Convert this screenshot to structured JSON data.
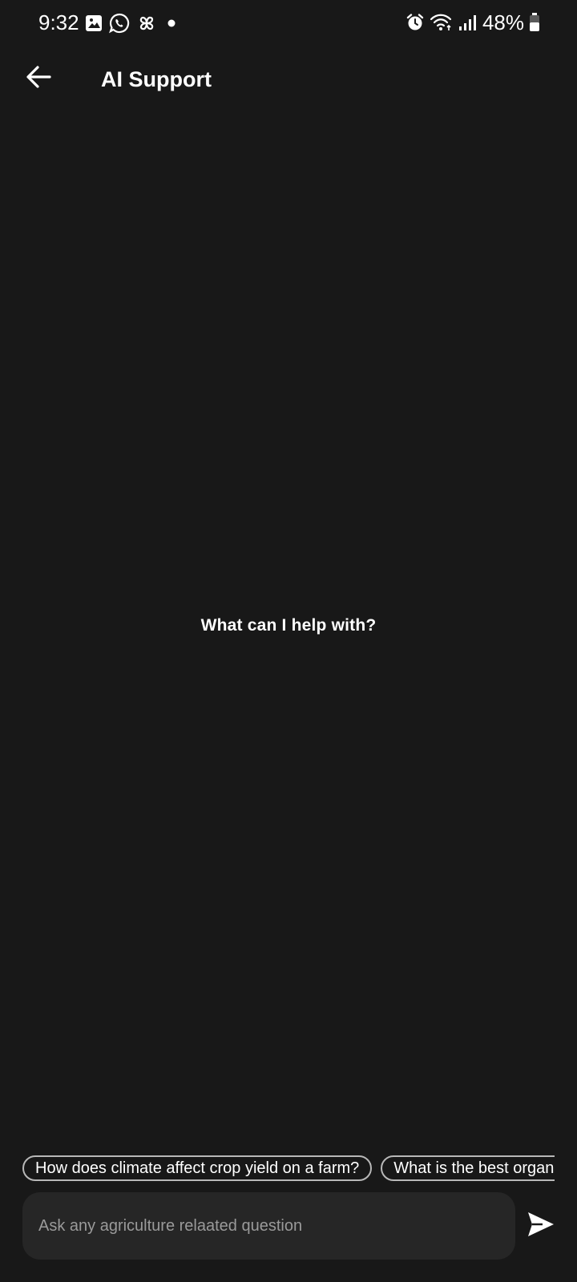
{
  "status_bar": {
    "time": "9:32",
    "battery_percent": "48%",
    "left_icons": [
      "gallery-icon",
      "whatsapp-icon",
      "pinwheel-icon",
      "notification-dot-icon"
    ],
    "right_icons": [
      "alarm-icon",
      "wifi-icon",
      "signal-icon",
      "battery-icon"
    ]
  },
  "app_bar": {
    "back_icon": "arrow-left-icon",
    "title": "AI Support"
  },
  "empty_state": {
    "prompt": "What can I help with?"
  },
  "suggestions": [
    "How does climate affect crop yield on a farm?",
    "What is the best organic fertilizer?"
  ],
  "composer": {
    "placeholder": "Ask any agriculture relaated question",
    "send_icon": "send-icon"
  },
  "colors": {
    "background": "#181818",
    "input_background": "#262626",
    "chip_border": "#b8b8b8",
    "text": "#ffffff",
    "placeholder": "#9a9a9a"
  }
}
